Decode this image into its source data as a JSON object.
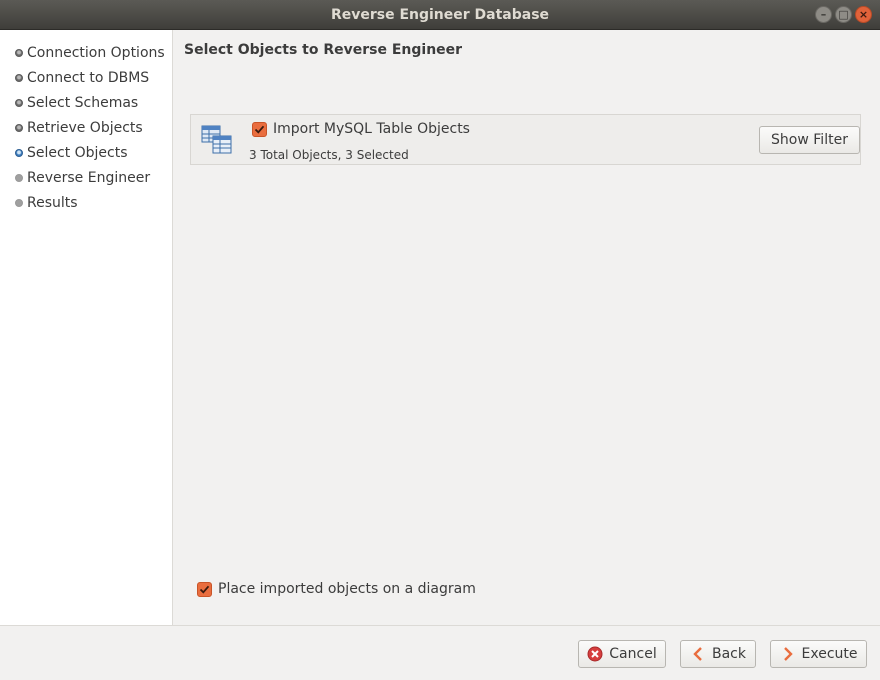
{
  "window": {
    "title": "Reverse Engineer Database",
    "controls": {
      "minimize": "–",
      "maximize": "□",
      "close": "×"
    }
  },
  "sidebar": {
    "steps": [
      {
        "label": "Connection Options",
        "state": "done"
      },
      {
        "label": "Connect to DBMS",
        "state": "done"
      },
      {
        "label": "Select Schemas",
        "state": "done"
      },
      {
        "label": "Retrieve Objects",
        "state": "done"
      },
      {
        "label": "Select Objects",
        "state": "active"
      },
      {
        "label": "Reverse Engineer",
        "state": "pending"
      },
      {
        "label": "Results",
        "state": "pending"
      }
    ]
  },
  "main": {
    "title": "Select Objects to Reverse Engineer",
    "object_group": {
      "icon": "table-objects-icon",
      "label": "Import MySQL Table Objects",
      "checked": true,
      "summary": "3 Total Objects, 3 Selected",
      "filter_button": "Show Filter"
    },
    "place_on_diagram": {
      "label": "Place imported objects on a diagram",
      "checked": true
    }
  },
  "footer": {
    "cancel": "Cancel",
    "back": "Back",
    "execute": "Execute"
  },
  "colors": {
    "accent": "#e96d3e",
    "titlebar": "#3f3e3a",
    "window_bg": "#f2f1f0",
    "cancel_icon": "#d63e3e"
  }
}
